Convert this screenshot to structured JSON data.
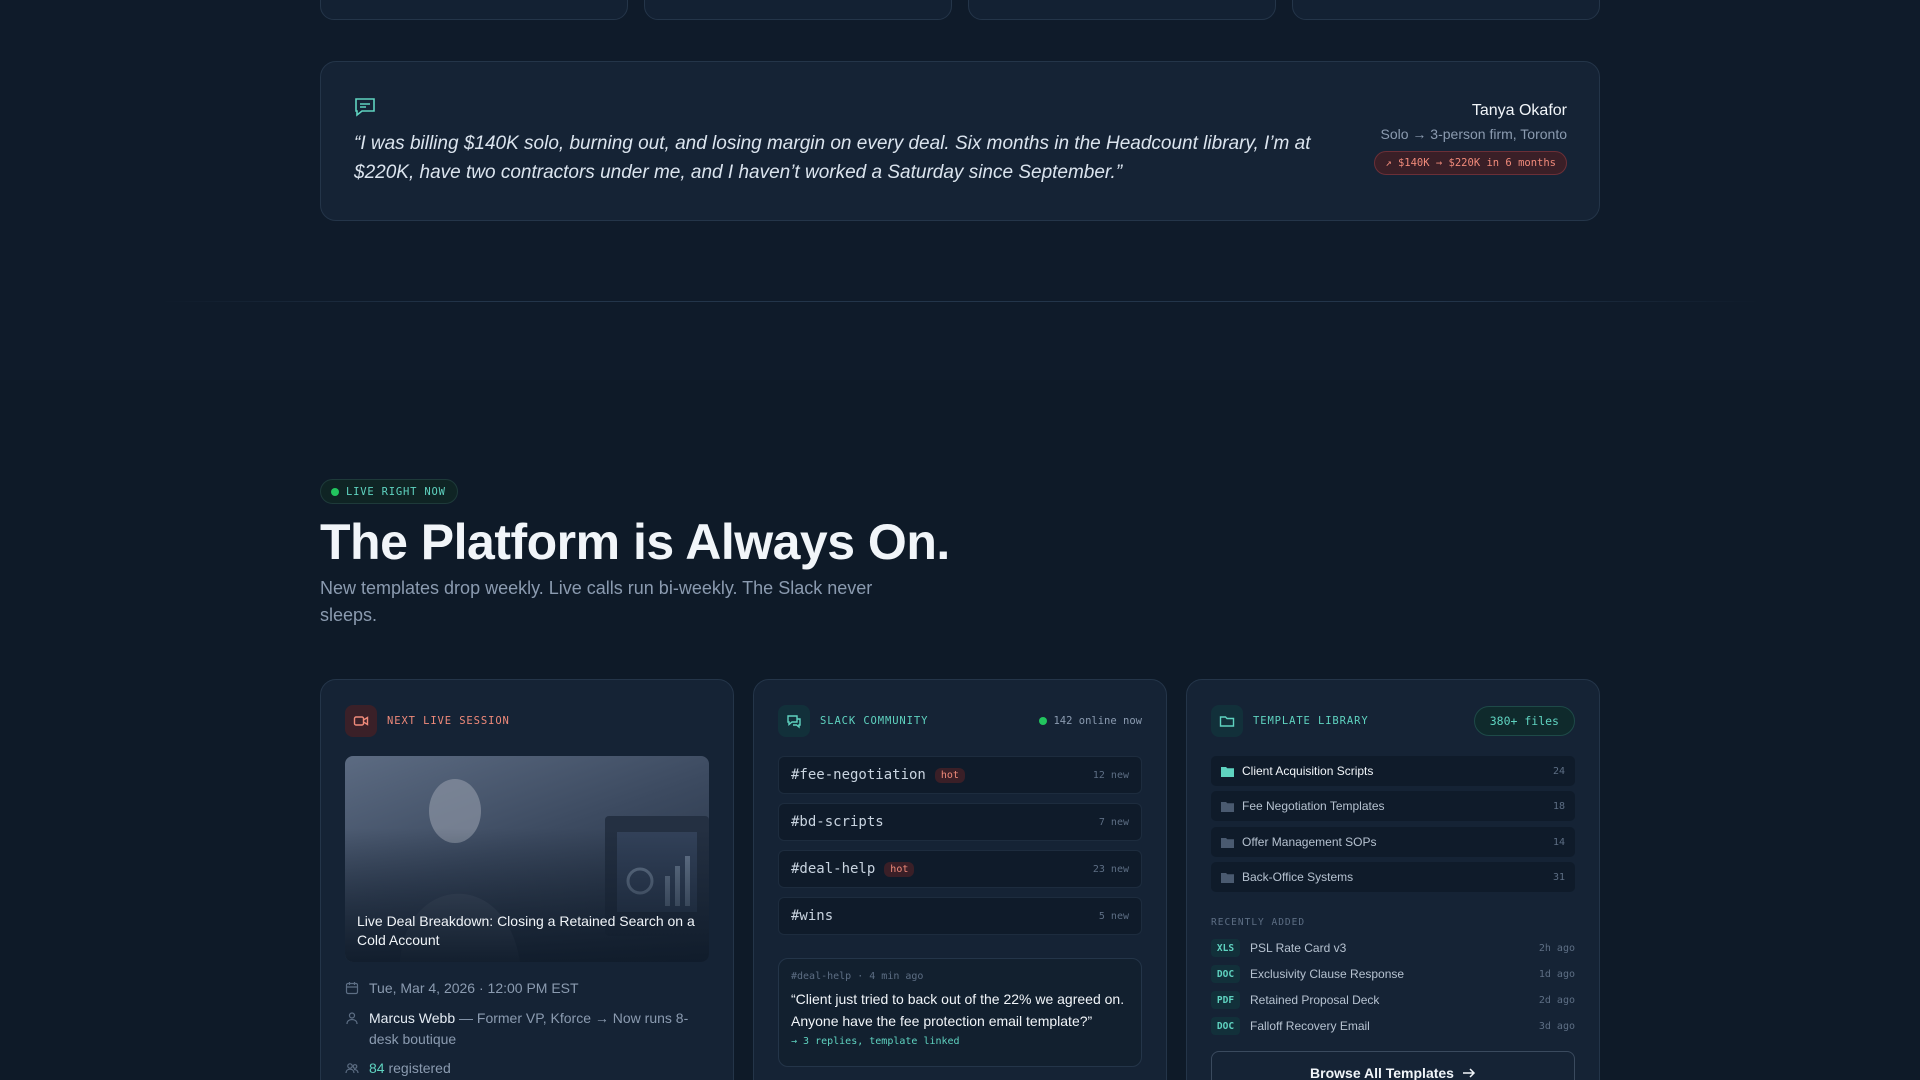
{
  "testimonial": {
    "quote": "“I was billing $140K solo, burning out, and losing margin on every deal. Six months in the Headcount library, I’m at $220K, have two contractors under me, and I haven’t worked a Saturday since September.”",
    "author_name": "Tanya Okafor",
    "author_meta": "Solo → 3-person firm, Toronto",
    "growth_badge": "↗ $140K → $220K in 6 months"
  },
  "section": {
    "live_label": "LIVE RIGHT NOW",
    "headline": "The Platform is Always On.",
    "subhead": "New templates drop weekly. Live calls run bi-weekly. The Slack never sleeps."
  },
  "session_card": {
    "title": "NEXT LIVE SESSION",
    "session_title": "Live Deal Breakdown: Closing a Retained Search on a Cold Account",
    "date": "Tue, Mar 4, 2026 · 12:00 PM EST",
    "host_name": "Marcus Webb",
    "host_bio": "— Former VP, Kforce → Now runs 8-desk boutique",
    "registered_count": "84",
    "registered_label": "registered"
  },
  "slack_card": {
    "title": "SLACK COMMUNITY",
    "online": "142 online now",
    "channels": [
      {
        "name": "#fee-negotiation",
        "hot": "hot",
        "count": "12 new"
      },
      {
        "name": "#bd-scripts",
        "hot": "",
        "count": "7 new"
      },
      {
        "name": "#deal-help",
        "hot": "hot",
        "count": "23 new"
      },
      {
        "name": "#wins",
        "hot": "",
        "count": "5 new"
      }
    ],
    "message": {
      "meta": "#deal-help · 4 min ago",
      "text": "“Client just tried to back out of the 22% we agreed on. Anyone have the fee protection email template?”",
      "replies": "→ 3 replies, template linked"
    }
  },
  "template_card": {
    "title": "TEMPLATE LIBRARY",
    "files_badge": "380+ files",
    "folders": [
      {
        "name": "Client Acquisition Scripts",
        "count": "24"
      },
      {
        "name": "Fee Negotiation Templates",
        "count": "18"
      },
      {
        "name": "Offer Management SOPs",
        "count": "14"
      },
      {
        "name": "Back-Office Systems",
        "count": "31"
      }
    ],
    "recent_label": "RECENTLY ADDED",
    "recent": [
      {
        "type": "XLS",
        "name": "PSL Rate Card v3",
        "ago": "2h ago"
      },
      {
        "type": "DOC",
        "name": "Exclusivity Clause Response",
        "ago": "1d ago"
      },
      {
        "type": "PDF",
        "name": "Retained Proposal Deck",
        "ago": "2d ago"
      },
      {
        "type": "DOC",
        "name": "Falloff Recovery Email",
        "ago": "3d ago"
      }
    ],
    "browse_label": "Browse All Templates"
  },
  "colors": {
    "accent": "#5fd3c0",
    "hot": "#f08a7a",
    "live": "#22c55e",
    "background": "#0f1b2a",
    "card": "#152335"
  }
}
